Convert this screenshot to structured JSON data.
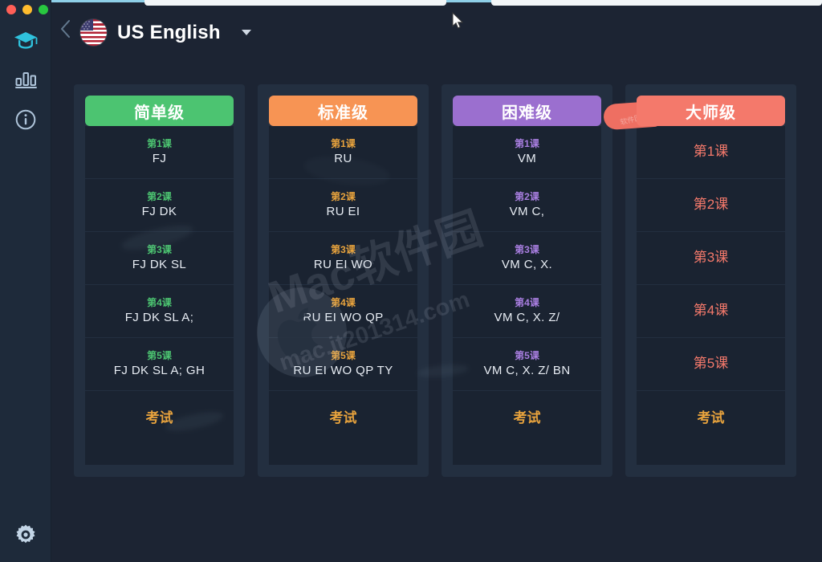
{
  "window": {
    "traffic_lights": [
      "close",
      "minimize",
      "zoom"
    ],
    "colors": {
      "close": "#ff5f57",
      "minimize": "#febc2e",
      "zoom": "#28c840",
      "sidebar_bg": "#1e2a3a",
      "main_bg": "#1c2433",
      "card_bg": "#232f40",
      "list_bg": "#1a2331",
      "accent_active": "#2fc2dd",
      "exam": "#e8a33d"
    }
  },
  "sidebar": {
    "items": [
      {
        "icon": "graduation-cap-icon",
        "name": "sidebar-item-learn",
        "active": true
      },
      {
        "icon": "bar-chart-icon",
        "name": "sidebar-item-statistics",
        "active": false
      },
      {
        "icon": "info-circle-icon",
        "name": "sidebar-item-info",
        "active": false
      },
      {
        "icon": "gear-icon",
        "name": "sidebar-item-settings",
        "active": false
      }
    ]
  },
  "header": {
    "back_icon": "chevron-left-icon",
    "flag": "us-flag-icon",
    "language": "US English",
    "dropdown_icon": "chevron-down-icon"
  },
  "levels": [
    {
      "title": "简单级",
      "color": "#4cc471",
      "num_color": "#4cc471",
      "show_keys": true,
      "lessons": [
        {
          "num": "第1课",
          "keys": "FJ"
        },
        {
          "num": "第2课",
          "keys": "FJ DK"
        },
        {
          "num": "第3课",
          "keys": "FJ DK SL"
        },
        {
          "num": "第4课",
          "keys": "FJ DK SL A;"
        },
        {
          "num": "第5课",
          "keys": "FJ DK SL A; GH"
        }
      ],
      "exam": "考试"
    },
    {
      "title": "标准级",
      "color": "#f79454",
      "num_color": "#e8a33d",
      "show_keys": true,
      "lessons": [
        {
          "num": "第1课",
          "keys": "RU"
        },
        {
          "num": "第2课",
          "keys": "RU EI"
        },
        {
          "num": "第3课",
          "keys": "RU EI WO"
        },
        {
          "num": "第4课",
          "keys": "RU EI WO QP"
        },
        {
          "num": "第5课",
          "keys": "RU EI WO QP TY"
        }
      ],
      "exam": "考试"
    },
    {
      "title": "困难级",
      "color": "#9b6fcf",
      "num_color": "#a87ee0",
      "show_keys": true,
      "lessons": [
        {
          "num": "第1课",
          "keys": "VM"
        },
        {
          "num": "第2课",
          "keys": "VM C,"
        },
        {
          "num": "第3课",
          "keys": "VM C, X."
        },
        {
          "num": "第4课",
          "keys": "VM C, X. Z/"
        },
        {
          "num": "第5课",
          "keys": "VM C, X. Z/ BN"
        }
      ],
      "exam": "考试"
    },
    {
      "title": "大师级",
      "color": "#f4796b",
      "num_color": "#f4796b",
      "show_keys": false,
      "lessons": [
        {
          "num": "第1课",
          "keys": ""
        },
        {
          "num": "第2课",
          "keys": ""
        },
        {
          "num": "第3课",
          "keys": ""
        },
        {
          "num": "第4课",
          "keys": ""
        },
        {
          "num": "第5课",
          "keys": ""
        }
      ],
      "exam": "考试"
    }
  ],
  "watermark": {
    "brand": "Mac软件园",
    "url": "mac.it201314.com",
    "ribbon_text": "软件园.com"
  }
}
